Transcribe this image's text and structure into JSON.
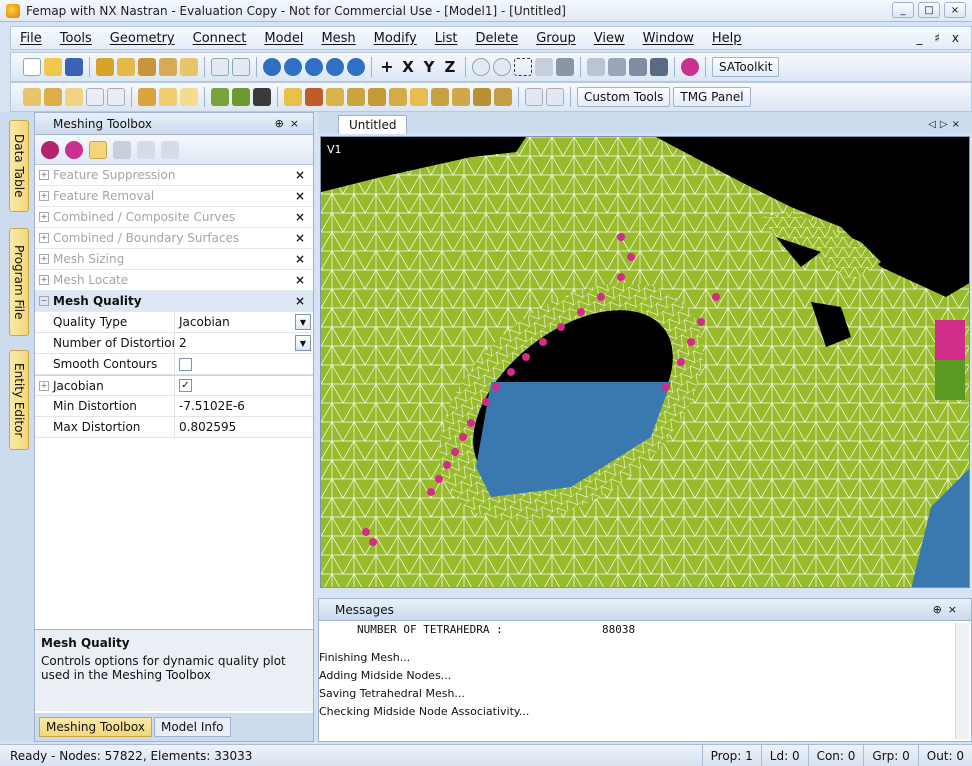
{
  "window": {
    "title": "Femap with NX Nastran - Evaluation Copy - Not for Commercial Use - [Model1] - [Untitled]",
    "controls": [
      "_",
      "□",
      "×"
    ]
  },
  "menu": {
    "items": [
      "File",
      "Tools",
      "Geometry",
      "Connect",
      "Model",
      "Mesh",
      "Modify",
      "List",
      "Delete",
      "Group",
      "View",
      "Window",
      "Help"
    ],
    "mdi_controls": "_ ♯ x"
  },
  "toolbar": {
    "satoolkit_label": "SAToolkit",
    "custom_tools_label": "Custom Tools",
    "tmg_panel_label": "TMG Panel"
  },
  "side_tabs": [
    "Data Table",
    "Program File",
    "Entity Editor"
  ],
  "meshing_toolbox": {
    "title": "Meshing Toolbox",
    "tools": [
      {
        "label": "Feature Suppression"
      },
      {
        "label": "Feature Removal"
      },
      {
        "label": "Combined / Composite Curves"
      },
      {
        "label": "Combined / Boundary Surfaces"
      },
      {
        "label": "Mesh Sizing"
      },
      {
        "label": "Mesh Locate"
      }
    ],
    "active_tool": "Mesh Quality",
    "close_glyph": "×",
    "properties": {
      "quality_type": {
        "name": "Quality Type",
        "value": "Jacobian"
      },
      "num_distortion": {
        "name": "Number of Distortion",
        "value": "2"
      },
      "smooth_contours": {
        "name": "Smooth Contours"
      },
      "jacobian": {
        "name": "Jacobian",
        "check": "✓"
      },
      "min_distortion": {
        "name": "Min Distortion",
        "value": "-7.5102E-6"
      },
      "max_distortion": {
        "name": "Max Distortion",
        "value": "0.802595"
      }
    },
    "help": {
      "title": "Mesh Quality",
      "text": "Controls options for dynamic quality plot used in the Meshing Toolbox"
    },
    "bottom_tabs": [
      "Meshing Toolbox",
      "Model Info"
    ]
  },
  "document": {
    "tab": "Untitled",
    "view_label": "V1"
  },
  "messages": {
    "title": "Messages",
    "mono_line": "NUMBER OF TETRAHEDRA :               88038",
    "lines": [
      "Finishing Mesh...",
      "Adding Midside Nodes...",
      "Saving Tetrahedral Mesh...",
      "Checking Midside Node Associativity..."
    ]
  },
  "status": {
    "left": "Ready - Nodes: 57822,  Elements: 33033",
    "prop": "Prop: 1",
    "ld": "Ld: 0",
    "con": "Con: 0",
    "grp": "Grp: 0",
    "out": "Out: 0"
  },
  "colors": {
    "mesh_green": "#97bb2a",
    "mesh_lines": "#ffffff",
    "highlight_magenta": "#d12c8a",
    "hole_blue": "#3a78b0",
    "background": "#000000"
  }
}
